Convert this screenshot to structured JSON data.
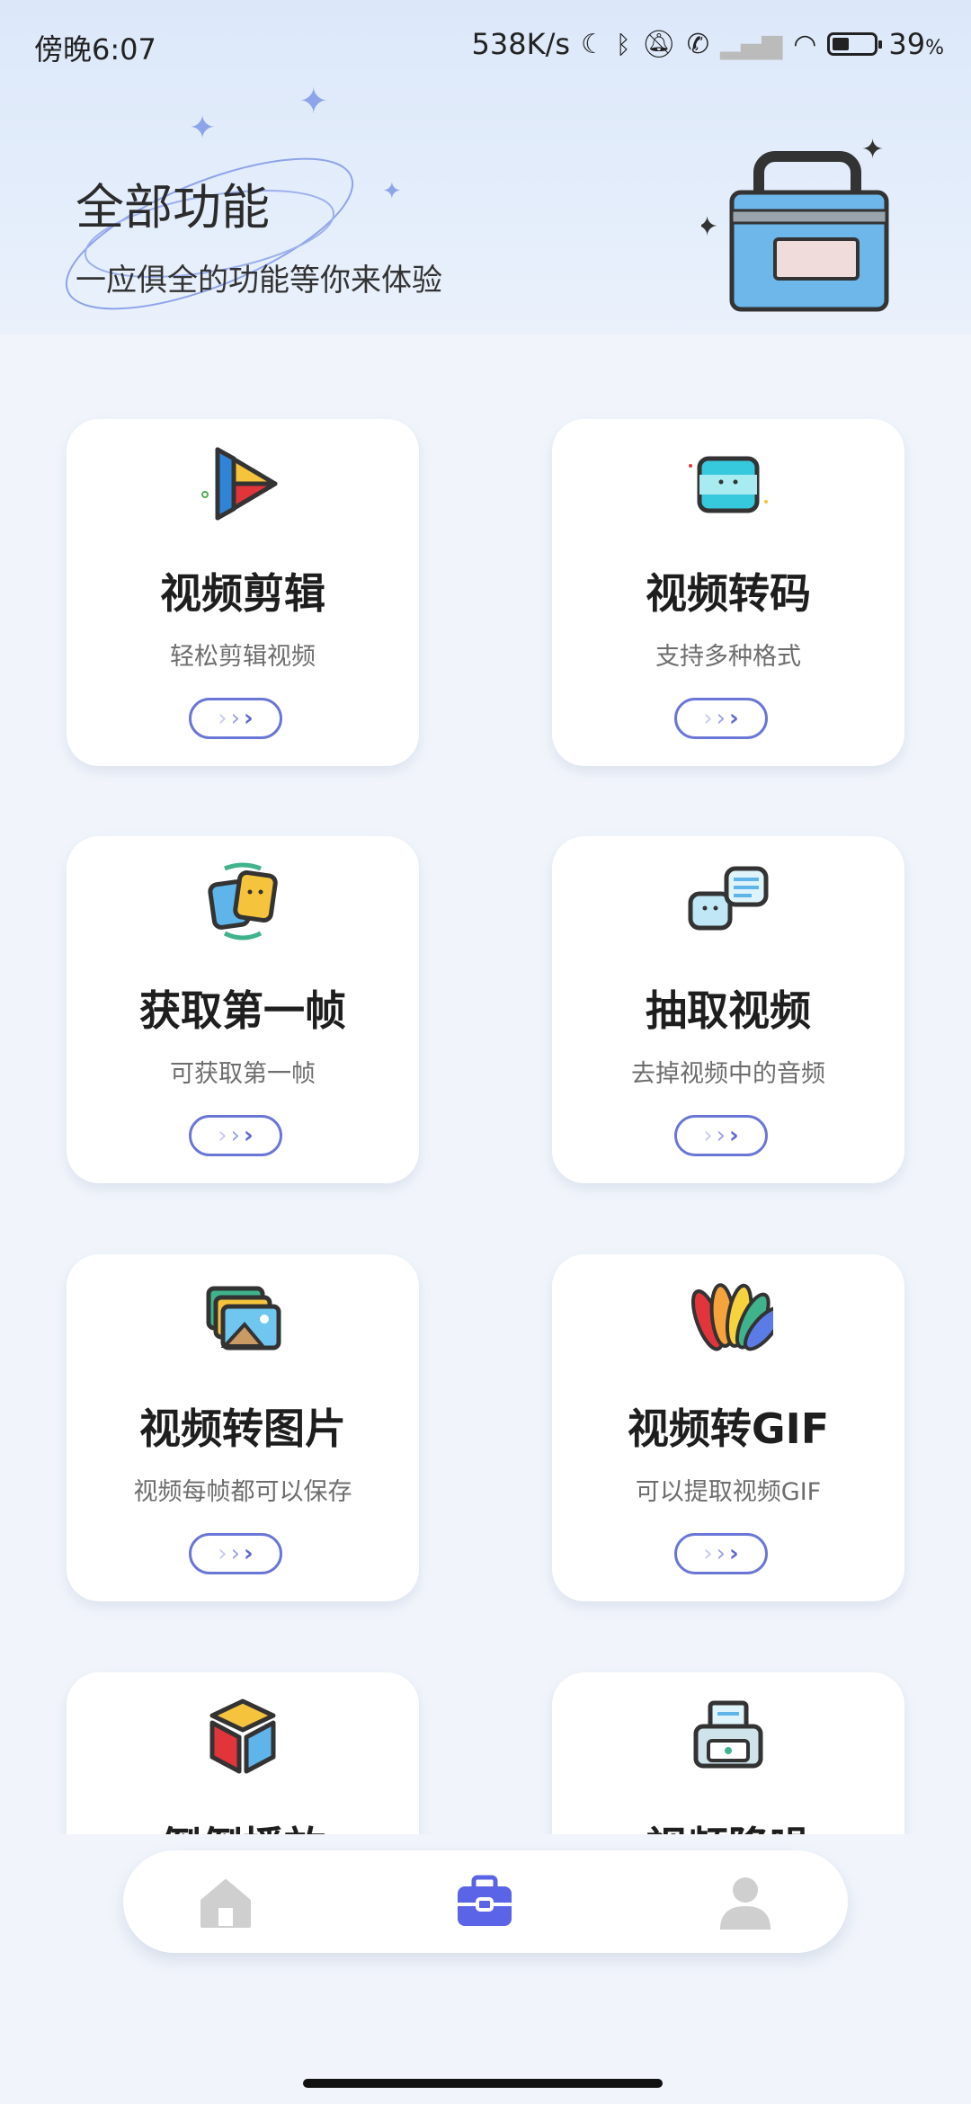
{
  "status_bar": {
    "time": "傍晚6:07",
    "network_speed": "538K/s",
    "battery_percent": "39",
    "battery_unit": "%",
    "icons": [
      "moon-icon",
      "bluetooth-icon",
      "mute-bell-icon",
      "call-icon",
      "signal-icon",
      "wifi-icon",
      "battery-icon"
    ]
  },
  "header": {
    "title": "全部功能",
    "subtitle": "一应俱全的功能等你来体验"
  },
  "cards": [
    {
      "title": "视频剪辑",
      "subtitle": "轻松剪辑视频",
      "icon": "play-icon"
    },
    {
      "title": "视频转码",
      "subtitle": "支持多种格式",
      "icon": "convert-icon"
    },
    {
      "title": "获取第一帧",
      "subtitle": "可获取第一帧",
      "icon": "frames-icon"
    },
    {
      "title": "抽取视频",
      "subtitle": "去掉视频中的音频",
      "icon": "chat-icon"
    },
    {
      "title": "视频转图片",
      "subtitle": "视频每帧都可以保存",
      "icon": "image-icon"
    },
    {
      "title": "视频转GIF",
      "subtitle": "可以提取视频GIF",
      "icon": "color-fan-icon"
    },
    {
      "title": "倒倒播放",
      "subtitle": "",
      "icon": "cube-icon"
    },
    {
      "title": "视频降噪",
      "subtitle": "",
      "icon": "printer-icon"
    }
  ],
  "nav": {
    "items": [
      "home-icon",
      "toolbox-icon",
      "profile-icon"
    ],
    "active_color": "#5b63e6",
    "inactive_color": "#cfcfcf"
  }
}
